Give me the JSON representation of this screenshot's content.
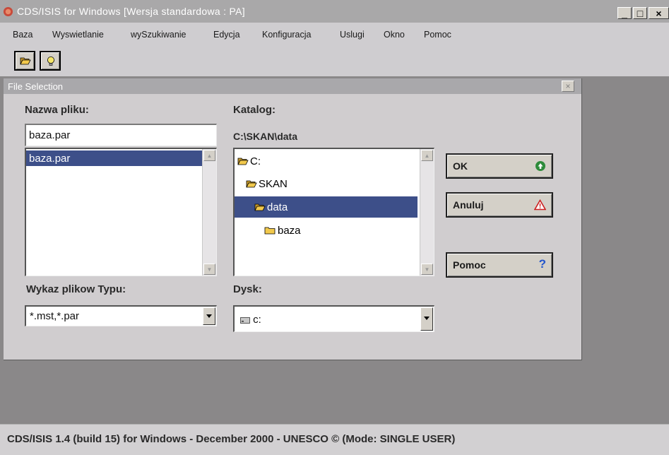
{
  "window": {
    "title": "CDS/ISIS for Windows [Wersja standardowa : PA]",
    "min_glyph": "_",
    "max_glyph": "□",
    "close_glyph": "×"
  },
  "menu": [
    "Baza",
    "Wyswietlanie",
    "wySzukiwanie",
    "Edycja",
    "Konfiguracja",
    "Uslugi",
    "Okno",
    "Pomoc"
  ],
  "toolbar": {
    "buttons": [
      {
        "name": "open-folder",
        "icon": "open-folder-icon"
      },
      {
        "name": "lightbulb",
        "icon": "lightbulb-icon"
      }
    ]
  },
  "dialog": {
    "title": "File Selection",
    "close_glyph": "×",
    "filename_label": "Nazwa pliku:",
    "filename_value": "baza.par",
    "files": [
      "baza.par"
    ],
    "selected_file": "baza.par",
    "filetype_label": "Wykaz plikow Typu:",
    "filetype_value": "*.mst,*.par",
    "dir_label": "Katalog:",
    "dir_path": "C:\\SKAN\\data",
    "dirs": [
      {
        "label": "C:",
        "icon": "open-folder-icon",
        "selected": false
      },
      {
        "label": "SKAN",
        "icon": "open-folder-icon",
        "selected": false
      },
      {
        "label": "data",
        "icon": "open-folder-icon",
        "selected": true
      },
      {
        "label": "baza",
        "icon": "folder-icon",
        "selected": false
      }
    ],
    "drive_label": "Dysk:",
    "drive_value": "c:",
    "ok_label": "OK",
    "cancel_label": "Anuluj",
    "help_label": "Pomoc"
  },
  "status": {
    "text": "CDS/ISIS 1.4 (build 15) for Windows - December 2000 - UNESCO © (Mode: SINGLE USER)"
  },
  "colors": {
    "selection": "#3d4f89",
    "ok_icon": "#2e8b3a",
    "warning_icon": "#cc1e1e",
    "help_icon": "#2255cc",
    "folder": "#f2c94c"
  }
}
